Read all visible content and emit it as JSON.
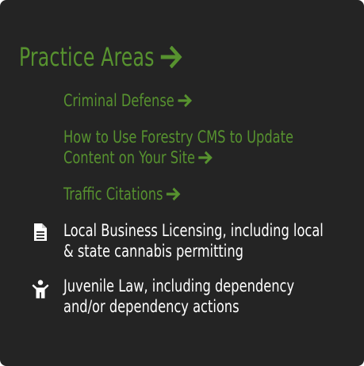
{
  "section": {
    "title": "Practice Areas",
    "accent_color": "#57922f",
    "background_color": "#242424"
  },
  "items": [
    {
      "label": "Criminal Defense",
      "linked": true,
      "icon": "arrow-right-icon"
    },
    {
      "label": "How to Use Forestry CMS to Update Content on Your Site",
      "linked": true,
      "icon": "arrow-right-icon"
    },
    {
      "label": "Traffic Citations",
      "linked": true,
      "icon": "arrow-right-icon"
    },
    {
      "label": "Local Business Licensing, including local & state cannabis permitting",
      "linked": false,
      "icon": "document-icon"
    },
    {
      "label": "Juvenile Law, including dependency and/or dependency actions",
      "linked": false,
      "icon": "child-icon"
    }
  ]
}
